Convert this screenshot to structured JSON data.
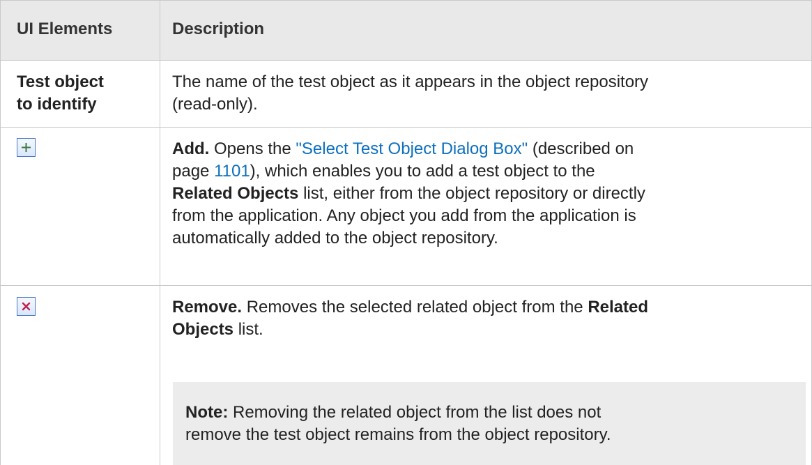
{
  "table": {
    "headers": [
      "UI Elements",
      "Description"
    ],
    "rows": [
      {
        "element_line1": "Test object",
        "element_line2": "to identify",
        "desc_line1": "The name of the test object as it appears in the object repository",
        "desc_line2": "(read-only)."
      },
      {
        "icon": "add-icon",
        "lead": "Add.",
        "line1_text": " Opens the ",
        "link_text": "\"Select Test Object Dialog Box\"",
        "line1_after": " (described on",
        "line2_before": "page ",
        "page_link": "1101",
        "line2_after": "), which enables you to add a test object to the",
        "line3_bold": "Related Objects",
        "line3_after": " list, either from the object repository or directly",
        "line4": "from the application. Any object you add from the application is",
        "line5": "automatically added to the object repository."
      },
      {
        "icon": "remove-icon",
        "lead": "Remove.",
        "line1_text": " Removes the selected related object from the ",
        "line1_bold_end": "Related",
        "line2_bold": "Objects",
        "line2_after": " list.",
        "note_label": "Note:",
        "note_line1": " Removing the related object from the list does not",
        "note_line2": "remove the test object remains from the object repository."
      }
    ]
  },
  "colors": {
    "header_bg": "#e9e9e9",
    "link": "#0b6fbf",
    "note_bg": "#ececec",
    "border": "#c9c9c9"
  }
}
